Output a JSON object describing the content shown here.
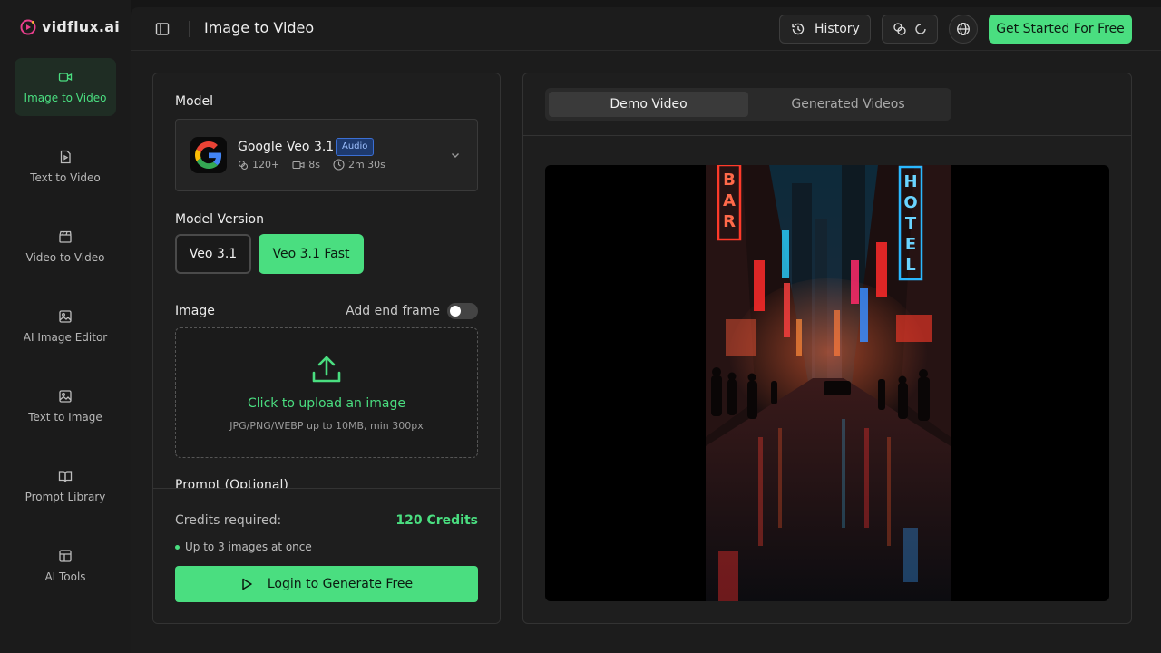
{
  "brand": {
    "name": "vidflux.ai",
    "accent": "#4ade80"
  },
  "sidebar": {
    "items": [
      {
        "label": "Image to Video",
        "icon": "video-camera-icon",
        "active": true
      },
      {
        "label": "Text to Video",
        "icon": "document-icon",
        "active": false
      },
      {
        "label": "Video to Video",
        "icon": "clapperboard-icon",
        "active": false
      },
      {
        "label": "AI Image Editor",
        "icon": "image-icon",
        "active": false
      },
      {
        "label": "Text to Image",
        "icon": "image-icon",
        "active": false
      },
      {
        "label": "Prompt Library",
        "icon": "book-icon",
        "active": false
      },
      {
        "label": "AI Tools",
        "icon": "layout-icon",
        "active": false
      }
    ]
  },
  "header": {
    "title": "Image to Video",
    "history_label": "History",
    "cta_label": "Get Started For Free"
  },
  "form": {
    "model_label": "Model",
    "model": {
      "name": "Google Veo 3.1",
      "badge": "Audio",
      "credits": "120+",
      "duration": "8s",
      "time": "2m 30s"
    },
    "version_label": "Model Version",
    "versions": [
      {
        "label": "Veo 3.1",
        "selected": false
      },
      {
        "label": "Veo 3.1 Fast",
        "selected": true
      }
    ],
    "image_label": "Image",
    "end_frame_label": "Add end frame",
    "end_frame_enabled": false,
    "upload_title": "Click to upload an image",
    "upload_hint": "JPG/PNG/WEBP up to 10MB, min 300px",
    "prompt_label": "Prompt (Optional)"
  },
  "footer": {
    "credits_label": "Credits required:",
    "credits_value": "120 Credits",
    "bullet": "Up to 3 images at once",
    "login_label": "Login to Generate Free"
  },
  "preview": {
    "tabs": [
      {
        "label": "Demo Video",
        "active": true
      },
      {
        "label": "Generated Videos",
        "active": false
      }
    ],
    "signs": {
      "bar": "BAR",
      "hotel": "HOTEL"
    }
  }
}
